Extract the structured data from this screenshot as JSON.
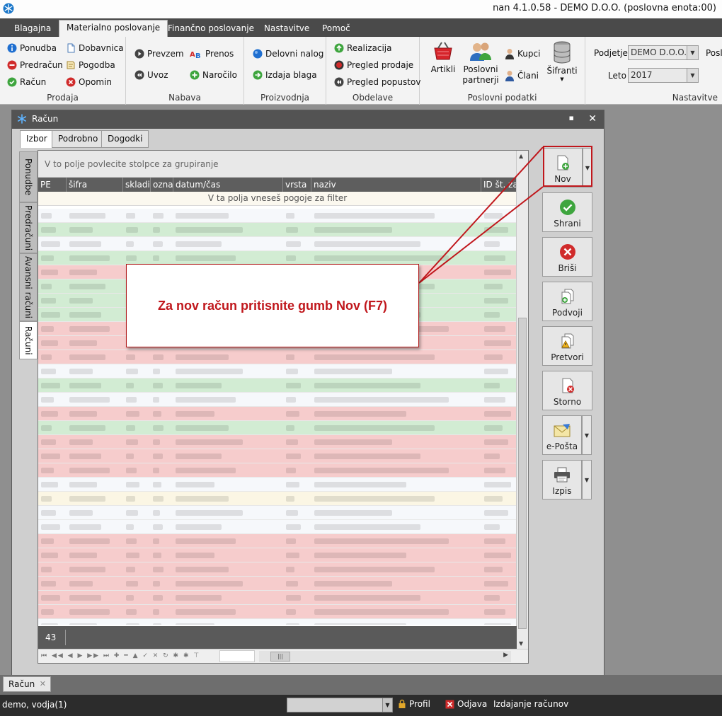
{
  "app": {
    "window_title": "nan 4.1.0.58 - DEMO D.O.O. (poslovna enota:00)"
  },
  "ribbon": {
    "tabs": [
      {
        "label": "Blagajna"
      },
      {
        "label": "Materialno poslovanje",
        "active": true
      },
      {
        "label": "Finančno poslovanje"
      },
      {
        "label": "Nastavitve"
      },
      {
        "label": "Pomoč"
      }
    ],
    "groups": {
      "prodaja": {
        "label": "Prodaja",
        "items": [
          "Ponudba",
          "Dobavnica",
          "Predračun",
          "Pogodba",
          "Račun",
          "Opomin"
        ]
      },
      "nabava": {
        "label": "Nabava",
        "items": [
          "Prevzem",
          "Prenos",
          "Uvoz",
          "Naročilo"
        ]
      },
      "proizvodnja": {
        "label": "Proizvodnja",
        "items": [
          "Delovni nalog",
          "Izdaja blaga"
        ]
      },
      "obdelave": {
        "label": "Obdelave",
        "items": [
          "Realizacija",
          "Pregled prodaje",
          "Pregled popustov"
        ]
      },
      "poslovni": {
        "label": "Poslovni podatki",
        "items": [
          "Artikli",
          "Poslovni partnerji",
          "Kupci",
          "Člani",
          "Šifranti"
        ]
      },
      "nastavitve": {
        "label": "Nastavitve",
        "podjetje_label": "Podjetje",
        "podjetje_value": "DEMO D.O.O.",
        "leto_label": "Leto",
        "leto_value": "2017",
        "extra_label": "Posl"
      }
    }
  },
  "window": {
    "title": "Račun",
    "tabs": [
      "Izbor",
      "Podrobno",
      "Dogodki"
    ],
    "side_tabs": [
      "Ponudbe",
      "Predračuni",
      "Avansni računi",
      "Računi"
    ]
  },
  "grid": {
    "group_hint": "V to polje povlecite stolpce za grupiranje",
    "filter_hint": "V ta polja vneseš pogoje za filter",
    "columns": [
      "PE",
      "šifra",
      "skladiš",
      "oznal",
      "datum/čas",
      "vrsta",
      "naziv",
      "ID št. za"
    ],
    "row_count": "43",
    "row_tints": [
      "white",
      "green",
      "white",
      "green",
      "red",
      "green",
      "green",
      "green",
      "red",
      "red",
      "red",
      "white",
      "green",
      "white",
      "red",
      "green",
      "red",
      "red",
      "red",
      "white",
      "yellow",
      "white",
      "white",
      "red",
      "red",
      "red",
      "red",
      "red",
      "red",
      "white",
      "yellow"
    ]
  },
  "actions": [
    "Nov",
    "Shrani",
    "Briši",
    "Podvoji",
    "Pretvori",
    "Storno",
    "e-Pošta",
    "Izpis"
  ],
  "callout": {
    "text": "Za nov račun pritisnite gumb Nov (F7)"
  },
  "mdi": {
    "tab_label": "Račun"
  },
  "status": {
    "user": "demo, vodja(1)",
    "profile": "Profil",
    "logout": "Odjava",
    "module": "Izdajanje računov"
  },
  "colors": {
    "accent_red": "#c0171c",
    "row_green": "#d2ecd3",
    "row_red": "#f6cccc",
    "ribbon_dark": "#4a4a4a"
  }
}
